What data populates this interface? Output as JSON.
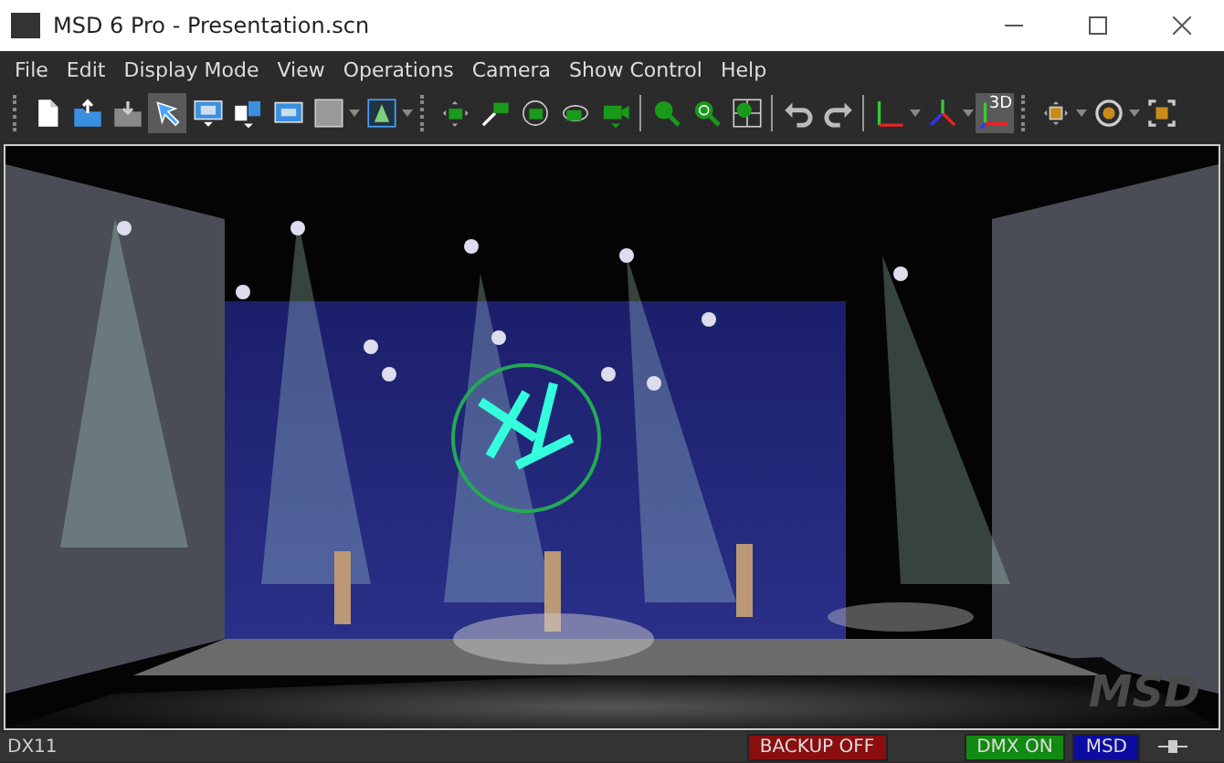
{
  "window": {
    "title": "MSD 6 Pro - Presentation.scn"
  },
  "menu": [
    "File",
    "Edit",
    "Display Mode",
    "View",
    "Operations",
    "Camera",
    "Show Control",
    "Help"
  ],
  "toolbar": [
    {
      "kind": "grip"
    },
    {
      "kind": "new",
      "selected": false
    },
    {
      "kind": "open",
      "selected": false
    },
    {
      "kind": "save",
      "selected": false
    },
    {
      "kind": "pointer",
      "selected": true
    },
    {
      "kind": "screen",
      "selected": false
    },
    {
      "kind": "copies",
      "selected": false
    },
    {
      "kind": "panel",
      "selected": false
    },
    {
      "kind": "gray",
      "selected": false
    },
    {
      "kind": "drop"
    },
    {
      "kind": "light",
      "selected": false
    },
    {
      "kind": "drop"
    },
    {
      "kind": "grip"
    },
    {
      "kind": "move",
      "selected": false
    },
    {
      "kind": "zoomcam",
      "selected": false
    },
    {
      "kind": "orbit",
      "selected": false
    },
    {
      "kind": "rotate",
      "selected": false
    },
    {
      "kind": "cam",
      "selected": false
    },
    {
      "kind": "sep"
    },
    {
      "kind": "zoom",
      "selected": false
    },
    {
      "kind": "zoomf",
      "selected": false
    },
    {
      "kind": "zoomgrid",
      "selected": false
    },
    {
      "kind": "sep"
    },
    {
      "kind": "undo",
      "selected": false
    },
    {
      "kind": "redo",
      "selected": false
    },
    {
      "kind": "sep"
    },
    {
      "kind": "axes",
      "selected": false
    },
    {
      "kind": "drop"
    },
    {
      "kind": "axes2",
      "selected": false
    },
    {
      "kind": "drop"
    },
    {
      "kind": "view3d",
      "selected": true,
      "label": "3D"
    },
    {
      "kind": "grip"
    },
    {
      "kind": "pan",
      "selected": false
    },
    {
      "kind": "drop"
    },
    {
      "kind": "target",
      "selected": false
    },
    {
      "kind": "drop"
    },
    {
      "kind": "frame",
      "selected": false
    }
  ],
  "viewport": {
    "logo": "MSD"
  },
  "status_bar": [
    {
      "kind": "text",
      "text": "DX11"
    },
    {
      "kind": "badge",
      "text": "BACKUP OFF",
      "color": "#8b0e0e"
    },
    {
      "kind": "badge",
      "text": "DMX ON",
      "color": "#118a11"
    },
    {
      "kind": "badge",
      "text": "MSD",
      "color": "#0c0ca0"
    },
    {
      "kind": "plug"
    }
  ]
}
